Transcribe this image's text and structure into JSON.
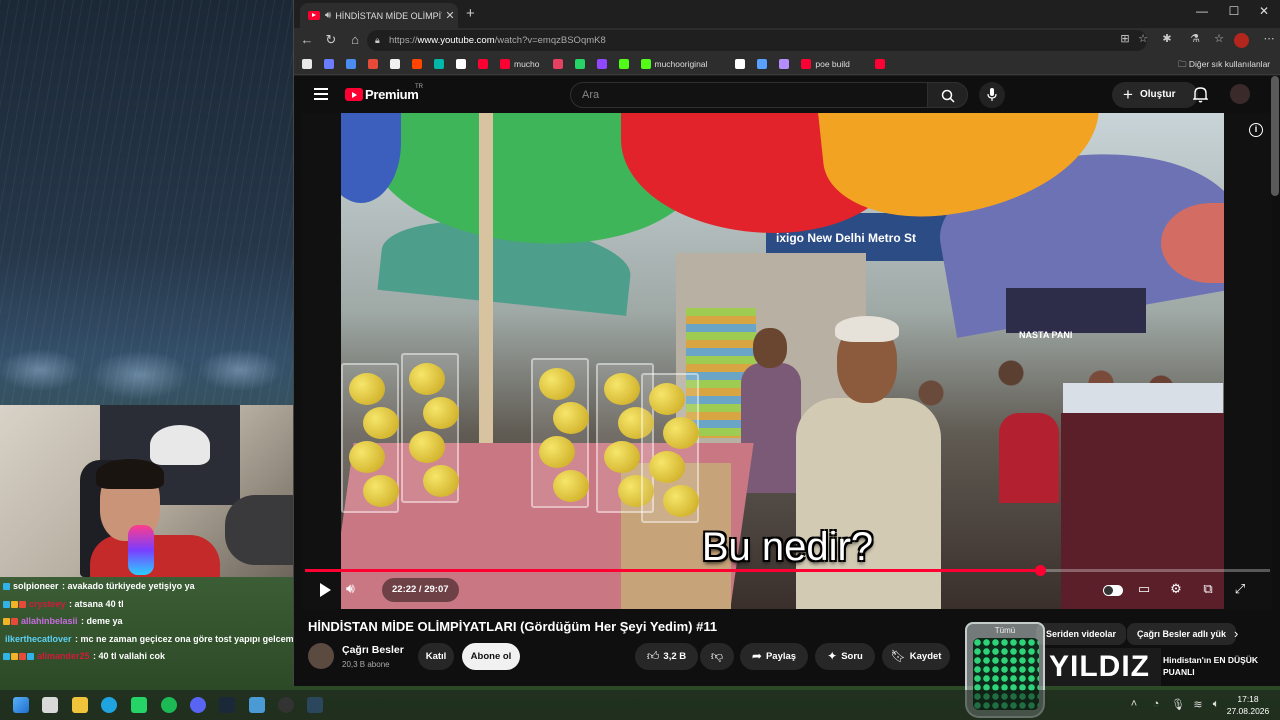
{
  "chat": [
    {
      "user": "solpioneer",
      "user_color": "#ffffff",
      "badges": [
        "#2fb3e8"
      ],
      "message": " : avakado türkiyede yetişiyo ya"
    },
    {
      "user": "crysteey",
      "user_color": "#d11b3a",
      "badges": [
        "#2fb3e8",
        "#f0b429",
        "#e84a3a"
      ],
      "message": " : atsana 40 tl"
    },
    {
      "user": "allahinbelasii",
      "user_color": "#c86ce0",
      "badges": [
        "#f0b429",
        "#e84a3a"
      ],
      "message": " : deme ya"
    },
    {
      "user": "ilkerthecatlover",
      "user_color": "#5cd1f5",
      "badges": [],
      "message": " : mc ne zaman geçicez ona göre tost yapıpı gelcem"
    },
    {
      "user": "alimander25",
      "user_color": "#d11b3a",
      "badges": [
        "#2fb3e8",
        "#f0b429",
        "#e84a3a",
        "#2fb3e8"
      ],
      "message": " : 40 tl vallahi cok"
    }
  ],
  "browser": {
    "tab_title": "HİNDİSTAN MİDE OLİMPİYATI",
    "url_prefix": "https://",
    "url_host": "www.youtube.com",
    "url_path": "/watch?v=emqzBSOqmK8",
    "bookmarks": [
      {
        "label": "",
        "color": "#e8e8e8"
      },
      {
        "label": "",
        "color": "#6b7cff"
      },
      {
        "label": "",
        "color": "#4a8cf0"
      },
      {
        "label": "",
        "color": "#e84a3a"
      },
      {
        "label": "",
        "color": "#f0f0f0"
      },
      {
        "label": "",
        "color": "#ff4500"
      },
      {
        "label": "",
        "color": "#00b8a9"
      },
      {
        "label": "",
        "color": "#ffffff"
      },
      {
        "label": "",
        "color": "#ff0033"
      },
      {
        "label": "mucho",
        "color": "#ff0033"
      },
      {
        "label": "",
        "color": "#e4405f"
      },
      {
        "label": "",
        "color": "#25d366"
      },
      {
        "label": "",
        "color": "#9146ff"
      },
      {
        "label": "",
        "color": "#53fc18"
      },
      {
        "label": "muchooriginal",
        "color": "#53fc18"
      },
      {
        "label": "",
        "color": "#ffffff"
      },
      {
        "label": "",
        "color": "#5aa0ff"
      },
      {
        "label": "",
        "color": "#b48cff"
      },
      {
        "label": "poe build",
        "color": "#ff0033"
      },
      {
        "label": "",
        "color": "#ff0033"
      }
    ],
    "other_bookmarks": "Diğer sık kullanılanlar"
  },
  "youtube": {
    "logo_text": "Premium",
    "country": "TR",
    "search_placeholder": "Ara",
    "create_label": "Oluştur",
    "video": {
      "subtitle": "Bu nedir?",
      "metro_sign": "ixigo New Delhi Metro St",
      "shop_sign": "NASTA PANI",
      "time_current": "22:22",
      "time_total": "29:07",
      "time_display": "22:22 / 29:07",
      "progress": 0.762
    },
    "title": "HİNDİSTAN MİDE OLİMPİYATLARI (Gördüğüm Her Şeyi Yedim) #11",
    "channel": {
      "name": "Çağrı Besler",
      "subscribers": "20,3 B abone"
    },
    "join_label": "Katıl",
    "subscribe_label": "Abone ol",
    "likes": "3,2 B",
    "share_label": "Paylaş",
    "ask_label": "Soru",
    "save_label": "Kaydet",
    "chips": [
      "Tümü",
      "Seriden videolar",
      "Çağrı Besler adlı yük"
    ],
    "recommendation": {
      "thumb_text": "YILDIZ",
      "title": "Hindistan'ın EN DÜŞÜK PUANLI"
    }
  },
  "overlay": {
    "label": "Tümü"
  },
  "taskbar": {
    "time": "17:18",
    "date": "27.08.2026"
  }
}
